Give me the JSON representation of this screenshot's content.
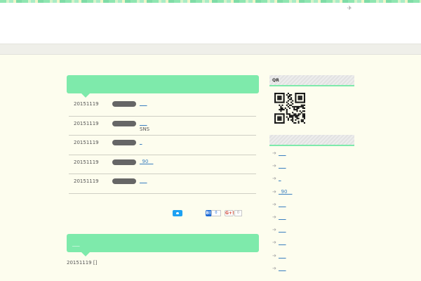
{
  "header": {
    "icon": "plane-icon"
  },
  "main": {
    "news_section": {
      "title": ""
    },
    "news": [
      {
        "date": "20151119",
        "link": "___",
        "sub": ""
      },
      {
        "date": "20151119",
        "link": "___",
        "sub": "SNS"
      },
      {
        "date": "20151119",
        "link": "_",
        "sub": ""
      },
      {
        "date": "20151119",
        "link": "_90__",
        "sub": ""
      },
      {
        "date": "20151119",
        "link": "___",
        "sub": ""
      }
    ],
    "share": {
      "hatena_label": "B!",
      "hatena_count": "0",
      "gplus_label": "G+!",
      "gplus_count": "0"
    },
    "blog_section": {
      "title": "___",
      "date": "20151119 []"
    }
  },
  "sidebar": {
    "qr_title": "QR",
    "list_title": "",
    "items": [
      "___",
      "___",
      "_",
      "_90__",
      "___",
      "___",
      "___",
      "___",
      "___",
      "___"
    ]
  },
  "colors": {
    "accent": "#7eeaab",
    "background": "#fdfdee",
    "link": "#3a7fc0"
  }
}
